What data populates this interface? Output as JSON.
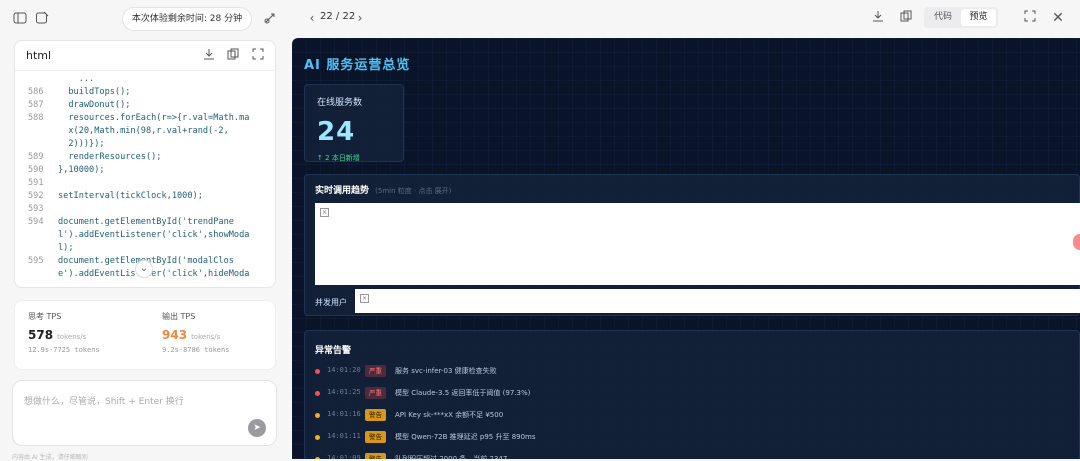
{
  "left": {
    "timer": "本次体验剩余时间: 28 分钟",
    "code": {
      "lang": "html",
      "lines": [
        {
          "n": "",
          "t": "    ..."
        },
        {
          "n": "586",
          "t": "  buildTops();"
        },
        {
          "n": "587",
          "t": "  drawDonut();"
        },
        {
          "n": "588",
          "t": "  resources.forEach(r=>{r.val=Math.ma"
        },
        {
          "n": "",
          "t": "  x(20,Math.min(98,r.val+rand(-2,"
        },
        {
          "n": "",
          "t": "  2)))});"
        },
        {
          "n": "589",
          "t": "  renderResources();"
        },
        {
          "n": "590",
          "t": "},10000);"
        },
        {
          "n": "591",
          "t": ""
        },
        {
          "n": "592",
          "t": "setInterval(tickClock,1000);"
        },
        {
          "n": "593",
          "t": ""
        },
        {
          "n": "594",
          "t": "document.getElementById('trendPane"
        },
        {
          "n": "",
          "t": "l').addEventListener('click',showModa"
        },
        {
          "n": "",
          "t": "l);"
        },
        {
          "n": "595",
          "t": "document.getElementById('modalClos"
        },
        {
          "n": "",
          "t": "e').addEventListener('click',hideModa"
        }
      ]
    },
    "tps": {
      "think_label": "思考 TPS",
      "think_value": "578",
      "think_unit": "tokens/s",
      "think_sub": "12.9s·7725 tokens",
      "out_label": "输出 TPS",
      "out_value": "943",
      "out_unit": "tokens/s",
      "out_sub": "9.2s·8786 tokens"
    },
    "input_placeholder": "想做什么，尽管说，Shift + Enter 换行",
    "footer": "内容由 AI 生成，请仔细甄别"
  },
  "right": {
    "pager": "22 / 22",
    "tab_code": "代码",
    "tab_preview": "预览"
  },
  "dash": {
    "title": "AI 服务运营总览",
    "online_label": "在线服务数",
    "online_value": "24",
    "online_new": "↑ 2 本日新增",
    "trend_title": "实时调用趋势",
    "trend_sub": "(5min 粒度 · 点击 展开)",
    "concurrent_label": "并发用户",
    "alerts_title": "异常告警",
    "alerts": [
      {
        "time": "14:01:20",
        "level": "严重",
        "msg": "服务 svc-infer-03 健康检查失败",
        "color": "#ff4d4f"
      },
      {
        "time": "14:01:25",
        "level": "严重",
        "msg": "模型 Claude-3.5 返回率低于阈值 (97.3%)",
        "color": "#ff4d4f"
      },
      {
        "time": "14:01:16",
        "level": "警告",
        "msg": "API Key sk-***xX 余额不足 ¥500",
        "color": "#faad14"
      },
      {
        "time": "14:01:11",
        "level": "警告",
        "msg": "模型 Qwen-72B 推理延迟 p95 升至 890ms",
        "color": "#faad14"
      },
      {
        "time": "14:01:09",
        "level": "警告",
        "msg": "队列积压超过 2000 条，当前 2347",
        "color": "#faad14"
      }
    ]
  }
}
